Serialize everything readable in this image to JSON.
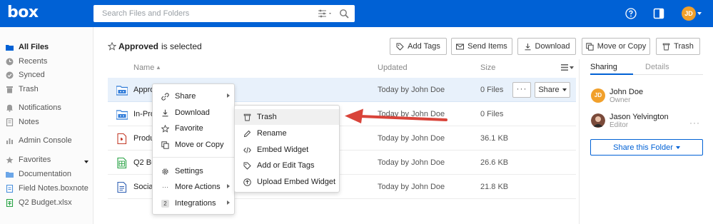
{
  "header": {
    "logo": "box",
    "search_placeholder": "Search Files and Folders",
    "avatar_initials": "JD",
    "brand_color": "#0061d5"
  },
  "sidebar": {
    "items": [
      {
        "label": "All Files",
        "icon": "folder-icon"
      },
      {
        "label": "Recents",
        "icon": "clock-icon"
      },
      {
        "label": "Synced",
        "icon": "check-circle-icon"
      },
      {
        "label": "Trash",
        "icon": "trash-icon"
      },
      {
        "label": "Notifications",
        "icon": "bell-icon"
      },
      {
        "label": "Notes",
        "icon": "notes-icon"
      },
      {
        "label": "Admin Console",
        "icon": "bar-chart-icon"
      },
      {
        "label": "Favorites",
        "icon": "star-icon"
      },
      {
        "label": "Documentation",
        "icon": "folder-icon"
      },
      {
        "label": "Field Notes.boxnote",
        "icon": "boxnote-icon"
      },
      {
        "label": "Q2 Budget.xlsx",
        "icon": "spreadsheet-icon"
      }
    ]
  },
  "toolbar": {
    "selected_name": "Approved",
    "selected_suffix": "is selected",
    "add_tags": "Add Tags",
    "send_items": "Send Items",
    "download": "Download",
    "move_or_copy": "Move or Copy",
    "trash": "Trash"
  },
  "table": {
    "headers": {
      "name": "Name",
      "updated": "Updated",
      "size": "Size"
    },
    "rows": [
      {
        "name": "Approved",
        "updated": "Today by John Doe",
        "size": "0 Files",
        "icon": "folder-icon"
      },
      {
        "name": "In-Progress",
        "updated": "Today by John Doe",
        "size": "0 Files",
        "icon": "folder-icon"
      },
      {
        "name": "Product",
        "updated": "Today by John Doe",
        "size": "36.1 KB",
        "icon": "presentation-icon"
      },
      {
        "name": "Q2 Budget",
        "updated": "Today by John Doe",
        "size": "26.6 KB",
        "icon": "spreadsheet-icon"
      },
      {
        "name": "Social",
        "updated": "Today by John Doe",
        "size": "21.8 KB",
        "icon": "document-icon"
      }
    ],
    "more_label": "···",
    "share_label": "Share"
  },
  "right_panel": {
    "tabs": [
      "Sharing",
      "Details"
    ],
    "collaborators": [
      {
        "name": "John Doe",
        "role": "Owner",
        "initials": "JD"
      },
      {
        "name": "Jason Yelvington",
        "role": "Editor"
      }
    ],
    "more_label": "···",
    "share_folder": "Share this Folder"
  },
  "context_menu": {
    "items": [
      {
        "label": "Share",
        "icon": "link-icon",
        "submenu": true
      },
      {
        "label": "Download",
        "icon": "download-icon"
      },
      {
        "label": "Favorite",
        "icon": "star-icon"
      },
      {
        "label": "Move or Copy",
        "icon": "copy-icon"
      },
      {
        "label": "Settings",
        "icon": "gear-icon"
      },
      {
        "label": "More Actions",
        "icon": "ellipsis-icon",
        "submenu": true
      },
      {
        "label": "Integrations",
        "icon": "integrations-icon",
        "badge": "2",
        "submenu": true
      }
    ]
  },
  "submenu": {
    "items": [
      {
        "label": "Trash",
        "icon": "trash-icon"
      },
      {
        "label": "Rename",
        "icon": "pencil-icon"
      },
      {
        "label": "Embed Widget",
        "icon": "code-icon"
      },
      {
        "label": "Add or Edit Tags",
        "icon": "tag-icon"
      },
      {
        "label": "Upload Embed Widget",
        "icon": "upload-icon"
      }
    ]
  },
  "annotation": {
    "arrow_color": "#d9443a"
  }
}
